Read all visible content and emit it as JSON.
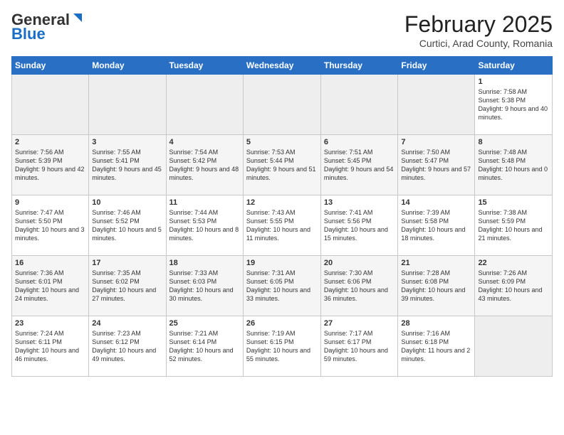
{
  "logo": {
    "general": "General",
    "blue": "Blue"
  },
  "title": {
    "month_year": "February 2025",
    "location": "Curtici, Arad County, Romania"
  },
  "weekdays": [
    "Sunday",
    "Monday",
    "Tuesday",
    "Wednesday",
    "Thursday",
    "Friday",
    "Saturday"
  ],
  "weeks": [
    [
      {
        "day": "",
        "info": ""
      },
      {
        "day": "",
        "info": ""
      },
      {
        "day": "",
        "info": ""
      },
      {
        "day": "",
        "info": ""
      },
      {
        "day": "",
        "info": ""
      },
      {
        "day": "",
        "info": ""
      },
      {
        "day": "1",
        "info": "Sunrise: 7:58 AM\nSunset: 5:38 PM\nDaylight: 9 hours and 40 minutes."
      }
    ],
    [
      {
        "day": "2",
        "info": "Sunrise: 7:56 AM\nSunset: 5:39 PM\nDaylight: 9 hours and 42 minutes."
      },
      {
        "day": "3",
        "info": "Sunrise: 7:55 AM\nSunset: 5:41 PM\nDaylight: 9 hours and 45 minutes."
      },
      {
        "day": "4",
        "info": "Sunrise: 7:54 AM\nSunset: 5:42 PM\nDaylight: 9 hours and 48 minutes."
      },
      {
        "day": "5",
        "info": "Sunrise: 7:53 AM\nSunset: 5:44 PM\nDaylight: 9 hours and 51 minutes."
      },
      {
        "day": "6",
        "info": "Sunrise: 7:51 AM\nSunset: 5:45 PM\nDaylight: 9 hours and 54 minutes."
      },
      {
        "day": "7",
        "info": "Sunrise: 7:50 AM\nSunset: 5:47 PM\nDaylight: 9 hours and 57 minutes."
      },
      {
        "day": "8",
        "info": "Sunrise: 7:48 AM\nSunset: 5:48 PM\nDaylight: 10 hours and 0 minutes."
      }
    ],
    [
      {
        "day": "9",
        "info": "Sunrise: 7:47 AM\nSunset: 5:50 PM\nDaylight: 10 hours and 3 minutes."
      },
      {
        "day": "10",
        "info": "Sunrise: 7:46 AM\nSunset: 5:52 PM\nDaylight: 10 hours and 5 minutes."
      },
      {
        "day": "11",
        "info": "Sunrise: 7:44 AM\nSunset: 5:53 PM\nDaylight: 10 hours and 8 minutes."
      },
      {
        "day": "12",
        "info": "Sunrise: 7:43 AM\nSunset: 5:55 PM\nDaylight: 10 hours and 11 minutes."
      },
      {
        "day": "13",
        "info": "Sunrise: 7:41 AM\nSunset: 5:56 PM\nDaylight: 10 hours and 15 minutes."
      },
      {
        "day": "14",
        "info": "Sunrise: 7:39 AM\nSunset: 5:58 PM\nDaylight: 10 hours and 18 minutes."
      },
      {
        "day": "15",
        "info": "Sunrise: 7:38 AM\nSunset: 5:59 PM\nDaylight: 10 hours and 21 minutes."
      }
    ],
    [
      {
        "day": "16",
        "info": "Sunrise: 7:36 AM\nSunset: 6:01 PM\nDaylight: 10 hours and 24 minutes."
      },
      {
        "day": "17",
        "info": "Sunrise: 7:35 AM\nSunset: 6:02 PM\nDaylight: 10 hours and 27 minutes."
      },
      {
        "day": "18",
        "info": "Sunrise: 7:33 AM\nSunset: 6:03 PM\nDaylight: 10 hours and 30 minutes."
      },
      {
        "day": "19",
        "info": "Sunrise: 7:31 AM\nSunset: 6:05 PM\nDaylight: 10 hours and 33 minutes."
      },
      {
        "day": "20",
        "info": "Sunrise: 7:30 AM\nSunset: 6:06 PM\nDaylight: 10 hours and 36 minutes."
      },
      {
        "day": "21",
        "info": "Sunrise: 7:28 AM\nSunset: 6:08 PM\nDaylight: 10 hours and 39 minutes."
      },
      {
        "day": "22",
        "info": "Sunrise: 7:26 AM\nSunset: 6:09 PM\nDaylight: 10 hours and 43 minutes."
      }
    ],
    [
      {
        "day": "23",
        "info": "Sunrise: 7:24 AM\nSunset: 6:11 PM\nDaylight: 10 hours and 46 minutes."
      },
      {
        "day": "24",
        "info": "Sunrise: 7:23 AM\nSunset: 6:12 PM\nDaylight: 10 hours and 49 minutes."
      },
      {
        "day": "25",
        "info": "Sunrise: 7:21 AM\nSunset: 6:14 PM\nDaylight: 10 hours and 52 minutes."
      },
      {
        "day": "26",
        "info": "Sunrise: 7:19 AM\nSunset: 6:15 PM\nDaylight: 10 hours and 55 minutes."
      },
      {
        "day": "27",
        "info": "Sunrise: 7:17 AM\nSunset: 6:17 PM\nDaylight: 10 hours and 59 minutes."
      },
      {
        "day": "28",
        "info": "Sunrise: 7:16 AM\nSunset: 6:18 PM\nDaylight: 11 hours and 2 minutes."
      },
      {
        "day": "",
        "info": ""
      }
    ]
  ]
}
